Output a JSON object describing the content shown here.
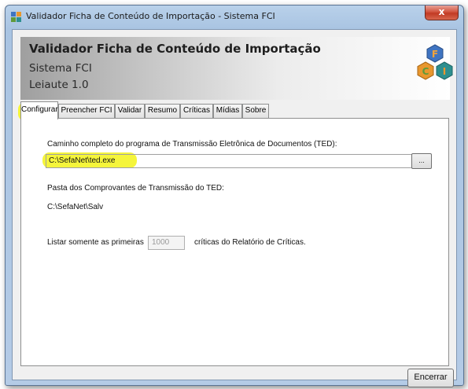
{
  "window": {
    "title": "Validador Ficha de Conteúdo de Importação - Sistema FCI",
    "close_label": "x"
  },
  "header": {
    "title": "Validador Ficha de Conteúdo de Importação",
    "subtitle": "Sistema FCI",
    "layout_version": "Leiaute 1.0",
    "logo_letters": [
      "F",
      "C",
      "I"
    ],
    "logo_colors": [
      "#3f74c1",
      "#e8972e",
      "#5f9a3a",
      "#2d8f8f"
    ]
  },
  "tabs": [
    {
      "label": "Configurar",
      "active": true
    },
    {
      "label": "Preencher FCI",
      "active": false
    },
    {
      "label": "Validar",
      "active": false
    },
    {
      "label": "Resumo",
      "active": false
    },
    {
      "label": "Críticas",
      "active": false
    },
    {
      "label": "Mídias",
      "active": false
    },
    {
      "label": "Sobre",
      "active": false
    }
  ],
  "config": {
    "ted_path_label": "Caminho completo do programa de Transmissão Eletrônica de Documentos (TED):",
    "ted_path_value": "C:\\SefaNet\\ted.exe",
    "browse_label": "...",
    "receipts_label": "Pasta dos Comprovantes de Transmissão do TED:",
    "receipts_value": "C:\\SefaNet\\Salv",
    "limit_prefix": "Listar somente as primeiras",
    "limit_value": "1000",
    "limit_suffix": "críticas do Relatório de Críticas."
  },
  "footer": {
    "close_button": "Encerrar"
  },
  "colors": {
    "highlight": "#f4f426"
  }
}
